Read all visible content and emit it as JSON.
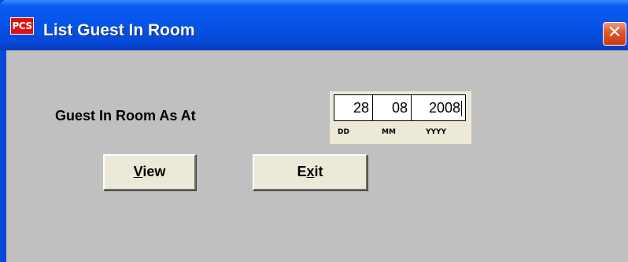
{
  "window": {
    "icon_text": "PCS",
    "title": "List Guest In Room",
    "close_glyph": "✕"
  },
  "form": {
    "label": "Guest In Room As At",
    "date": {
      "day": "28",
      "month": "08",
      "year": "2008",
      "day_caption": "DD",
      "month_caption": "MM",
      "year_caption": "YYYY"
    }
  },
  "buttons": {
    "view": {
      "accel": "V",
      "rest": "iew"
    },
    "exit": {
      "pre": "E",
      "accel": "x",
      "rest": "it"
    }
  },
  "colors": {
    "titlebar": "#0653e6",
    "client_bg": "#c0c0c0",
    "button_face": "#ece9d8",
    "close_button": "#e2582c",
    "icon_red": "#e01010"
  },
  "icons": {
    "app": "pcs-logo-icon",
    "close": "close-icon"
  }
}
